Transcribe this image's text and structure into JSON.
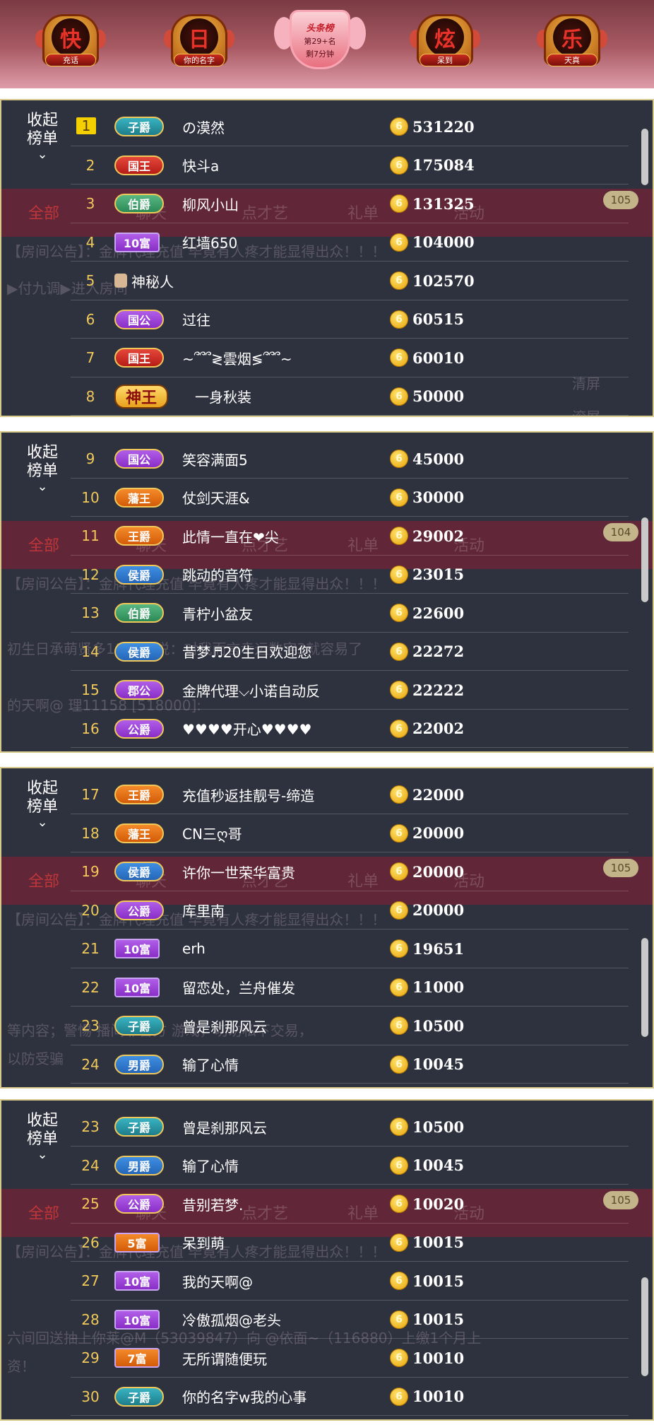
{
  "header": {
    "badges": [
      {
        "glyph": "快",
        "caption": "充话"
      },
      {
        "glyph": "日",
        "caption": "你的名字"
      },
      {
        "glyph": "炫",
        "caption": "呆到"
      },
      {
        "glyph": "乐",
        "caption": "天真"
      }
    ],
    "center": {
      "title": "头条榜",
      "rank": "第29+名",
      "countdown": "剩7分钟"
    }
  },
  "collapse_label_1": "收起",
  "collapse_label_2": "榜单",
  "background": {
    "tab_all": "全部",
    "tabs": [
      "聊天",
      "点才艺",
      "礼单",
      "活动"
    ],
    "announce": "【房间公告】：金牌代理充值 毕竟有人疼才能显得出众！！！",
    "counts": [
      "105",
      "104",
      "105",
      "105"
    ],
    "snippets": [
      "▶付九调▶进入房间",
      "清屏",
      "滚屏",
      "初生日承萌贤多11158|说：对我而言幸运数字3就容易了",
      "的天啊@  理11158 [518000]:",
      "等内容；警惕 播间非官方 游戏，切勿私下交易，",
      "以防受骗",
      "六间回送抽上你莱@M（53039847）向 @依面~（116880）上缴1个月上",
      "资！"
    ]
  },
  "panels": [
    {
      "rows": [
        {
          "rank": "1",
          "tag": "子爵",
          "tag_color": "teal",
          "name": "の漠然",
          "score": "531220"
        },
        {
          "rank": "2",
          "tag": "国王",
          "tag_color": "red",
          "name": "快斗a",
          "score": "175084"
        },
        {
          "rank": "3",
          "tag": "伯爵",
          "tag_color": "green",
          "name": "柳风小山",
          "score": "131325"
        },
        {
          "rank": "4",
          "tag": "10富",
          "tag_color": "purple",
          "name": "红墙650",
          "score": "104000"
        },
        {
          "rank": "5",
          "tag": "",
          "tag_color": "",
          "name": "神秘人",
          "score": "102570"
        },
        {
          "rank": "6",
          "tag": "国公",
          "tag_color": "purple",
          "name": "过往",
          "score": "60515"
        },
        {
          "rank": "7",
          "tag": "国王",
          "tag_color": "red",
          "name": "~՞՞՞≷雲烟≶՞՞՞~",
          "score": "60010"
        },
        {
          "rank": "8",
          "tag": "神王",
          "tag_color": "big",
          "name": "一身秋装",
          "score": "50000"
        }
      ]
    },
    {
      "rows": [
        {
          "rank": "9",
          "tag": "国公",
          "tag_color": "purple",
          "name": "笑容满面5",
          "score": "45000"
        },
        {
          "rank": "10",
          "tag": "藩王",
          "tag_color": "orange",
          "name": "仗剑天涯&",
          "score": "30000"
        },
        {
          "rank": "11",
          "tag": "王爵",
          "tag_color": "orange",
          "name": "此情一直在❤尖",
          "score": "29002"
        },
        {
          "rank": "12",
          "tag": "侯爵",
          "tag_color": "blue",
          "name": "跳动的音符",
          "score": "23015"
        },
        {
          "rank": "13",
          "tag": "伯爵",
          "tag_color": "green",
          "name": "青柠小盆友",
          "score": "22600"
        },
        {
          "rank": "14",
          "tag": "侯爵",
          "tag_color": "blue",
          "name": "昔梦♬20生日欢迎您",
          "score": "22272"
        },
        {
          "rank": "15",
          "tag": "郡公",
          "tag_color": "purple",
          "name": "金牌代理⌵小诺自动反",
          "score": "22222"
        },
        {
          "rank": "16",
          "tag": "公爵",
          "tag_color": "purple",
          "name": "♥♥♥♥开心♥♥♥♥",
          "score": "22002"
        }
      ]
    },
    {
      "rows": [
        {
          "rank": "17",
          "tag": "王爵",
          "tag_color": "orange",
          "name": "充值秒返挂靓号-缔造",
          "score": "22000"
        },
        {
          "rank": "18",
          "tag": "藩王",
          "tag_color": "orange",
          "name": "CN三ღ哥",
          "score": "20000"
        },
        {
          "rank": "19",
          "tag": "侯爵",
          "tag_color": "blue",
          "name": "许你一世荣华富贵",
          "score": "20000"
        },
        {
          "rank": "20",
          "tag": "公爵",
          "tag_color": "purple",
          "name": "库里南",
          "score": "20000"
        },
        {
          "rank": "21",
          "tag": "10富",
          "tag_color": "purple",
          "name": "erh",
          "score": "19651"
        },
        {
          "rank": "22",
          "tag": "10富",
          "tag_color": "purple",
          "name": "留恋处，兰舟催发",
          "score": "11000"
        },
        {
          "rank": "23",
          "tag": "子爵",
          "tag_color": "teal",
          "name": "曾是刹那风云",
          "score": "10500"
        },
        {
          "rank": "24",
          "tag": "男爵",
          "tag_color": "blue",
          "name": "输了心情",
          "score": "10045"
        }
      ]
    },
    {
      "rows": [
        {
          "rank": "23",
          "tag": "子爵",
          "tag_color": "teal",
          "name": "曾是刹那风云",
          "score": "10500"
        },
        {
          "rank": "24",
          "tag": "男爵",
          "tag_color": "blue",
          "name": "输了心情",
          "score": "10045"
        },
        {
          "rank": "25",
          "tag": "公爵",
          "tag_color": "purple",
          "name": "昔别若梦.",
          "score": "10020"
        },
        {
          "rank": "26",
          "tag": "5富",
          "tag_color": "orange",
          "name": "呆到萌",
          "score": "10015"
        },
        {
          "rank": "27",
          "tag": "10富",
          "tag_color": "purple",
          "name": "我的天啊@",
          "score": "10015"
        },
        {
          "rank": "28",
          "tag": "10富",
          "tag_color": "purple",
          "name": "冷傲孤烟@老头",
          "score": "10015"
        },
        {
          "rank": "29",
          "tag": "7富",
          "tag_color": "orange",
          "name": "无所谓随便玩",
          "score": "10010"
        },
        {
          "rank": "30",
          "tag": "子爵",
          "tag_color": "teal",
          "name": "你的名字w我的心事",
          "score": "10010"
        }
      ]
    }
  ],
  "coin_glyph": "6"
}
